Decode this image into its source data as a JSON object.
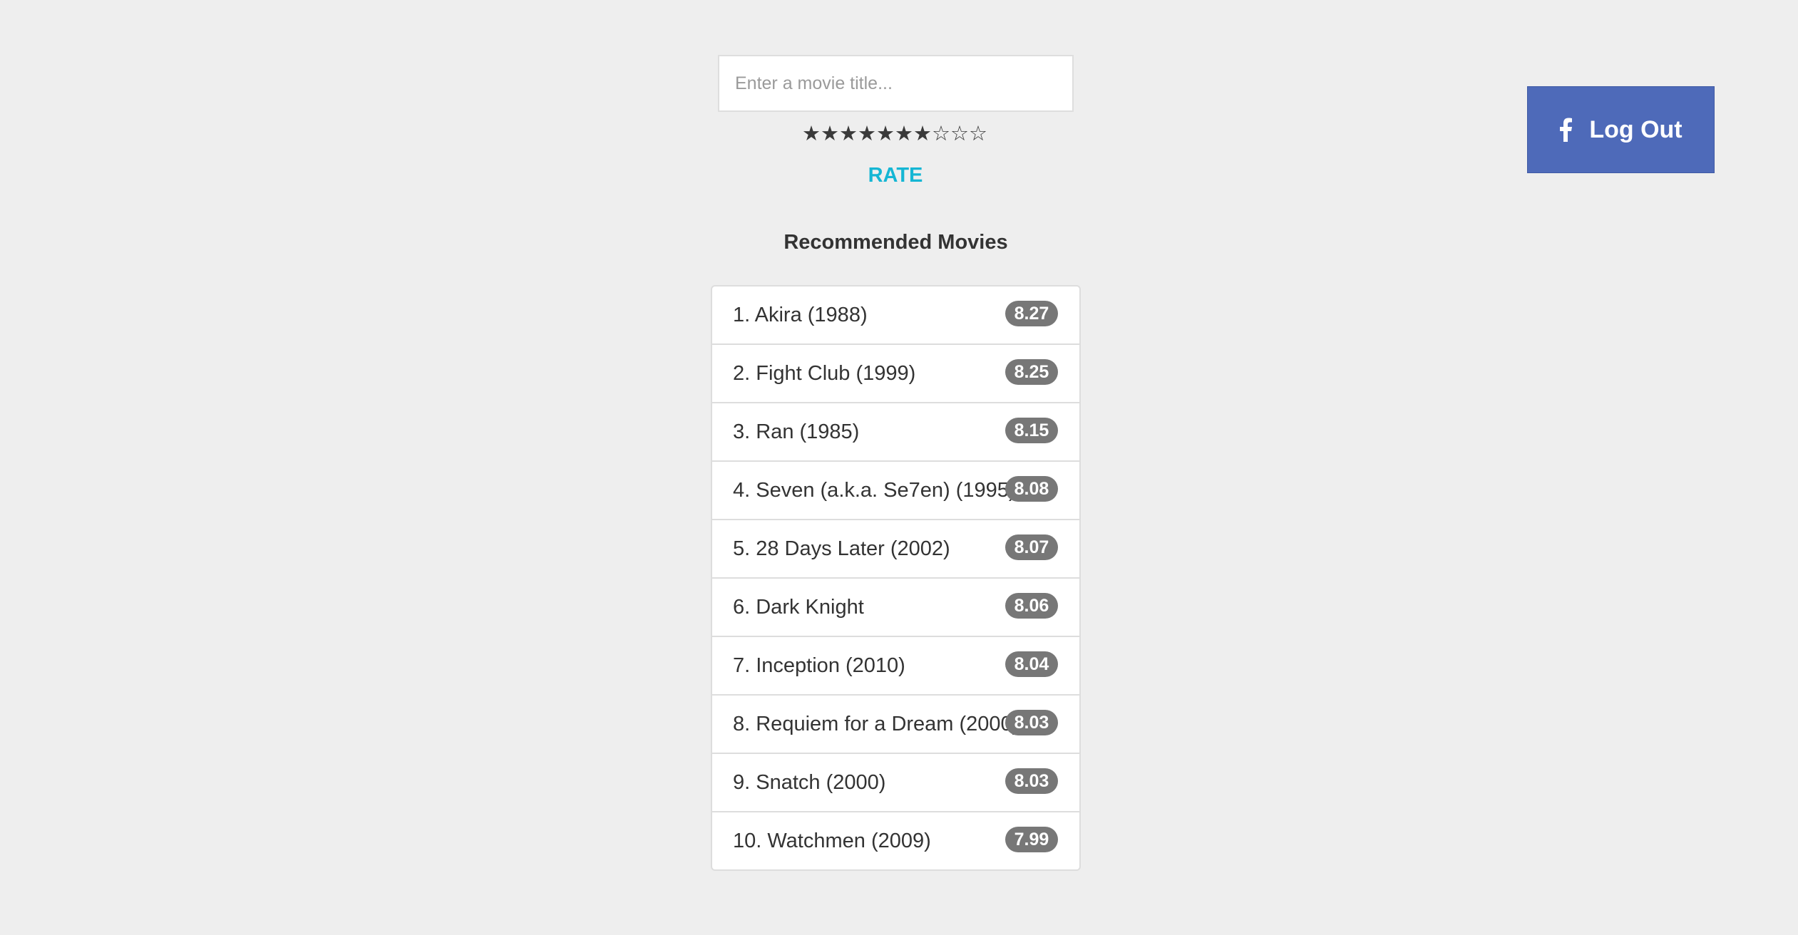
{
  "search": {
    "placeholder": "Enter a movie title...",
    "value": ""
  },
  "rating": {
    "selected": 7,
    "max": 10,
    "filled_symbol": "★",
    "empty_symbol": "☆"
  },
  "rate_button": {
    "label": "RATE",
    "color": "#15b6d4"
  },
  "logout_button": {
    "label": "Log Out",
    "icon": "facebook-icon",
    "color": "#4e6ab9"
  },
  "recommendations": {
    "title": "Recommended Movies",
    "items": [
      {
        "title": "1. Akira (1988)",
        "score": "8.27"
      },
      {
        "title": "2. Fight Club (1999)",
        "score": "8.25"
      },
      {
        "title": "3. Ran (1985)",
        "score": "8.15"
      },
      {
        "title": "4. Seven (a.k.a. Se7en) (1995)",
        "score": "8.08"
      },
      {
        "title": "5. 28 Days Later (2002)",
        "score": "8.07"
      },
      {
        "title": "6. Dark Knight",
        "score": "8.06"
      },
      {
        "title": "7. Inception (2010)",
        "score": "8.04"
      },
      {
        "title": "8. Requiem for a Dream (2000)",
        "score": "8.03"
      },
      {
        "title": "9. Snatch (2000)",
        "score": "8.03"
      },
      {
        "title": "10. Watchmen (2009)",
        "score": "7.99"
      }
    ]
  }
}
